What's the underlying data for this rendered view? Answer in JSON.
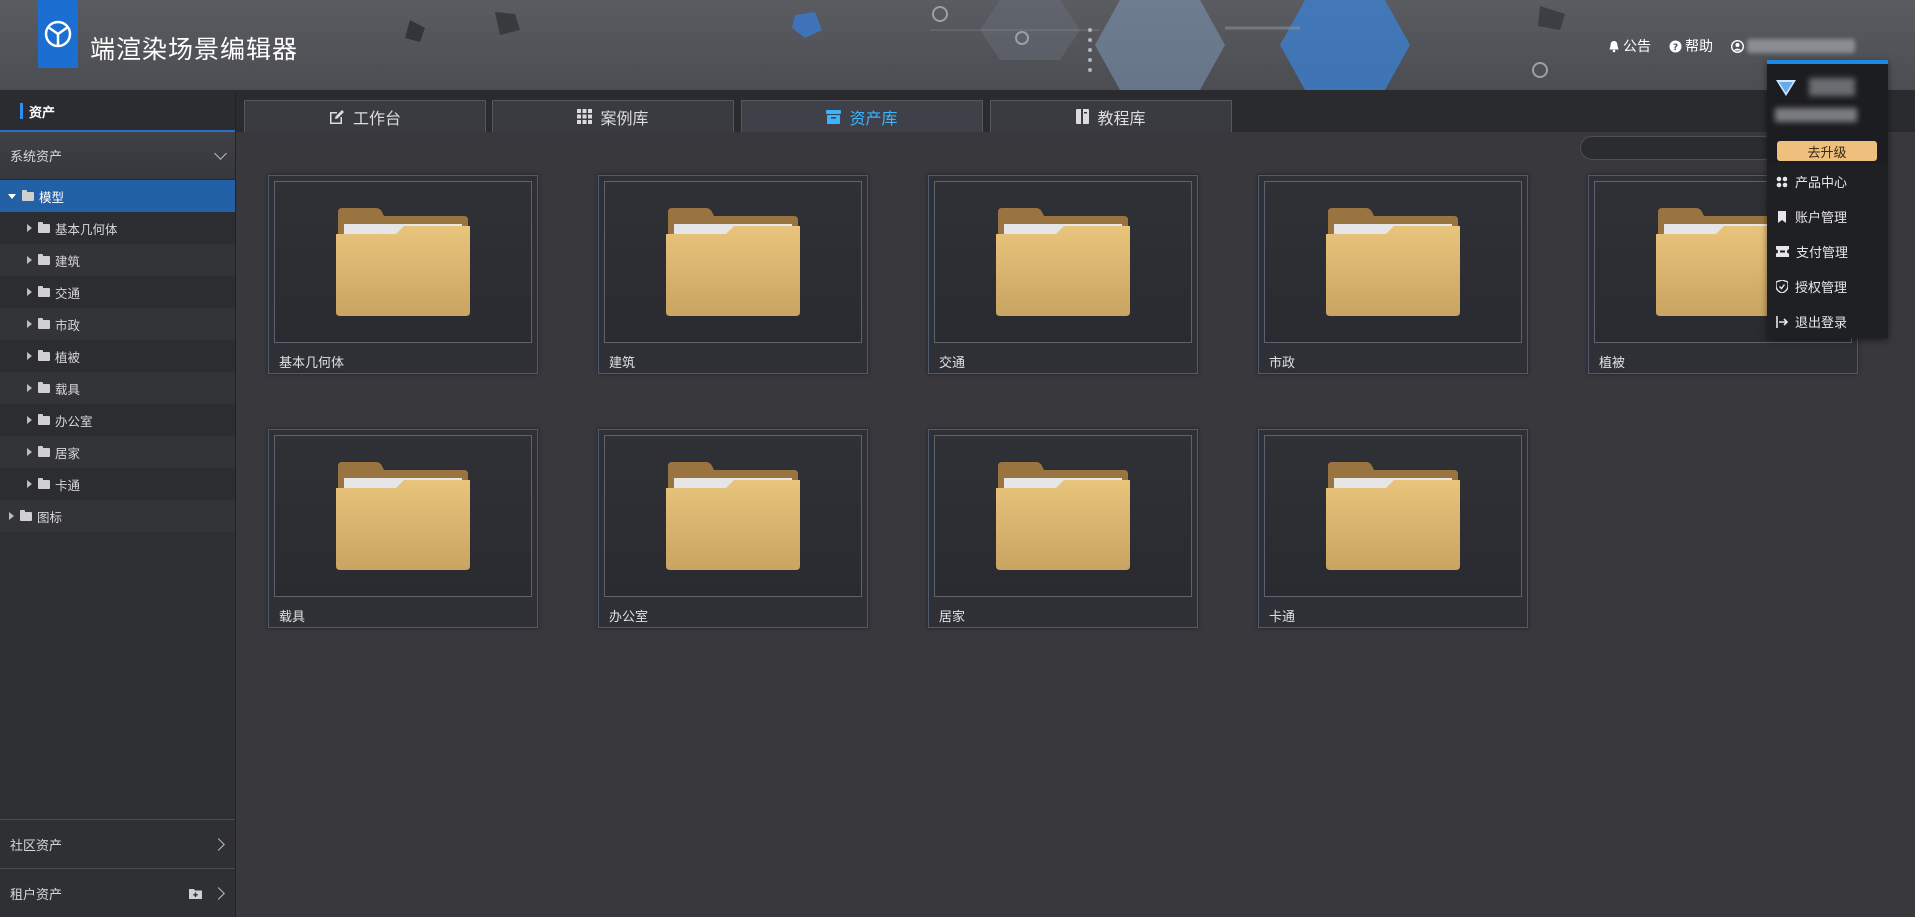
{
  "header": {
    "title": "端渲染场景编辑器",
    "notice_label": "公告",
    "help_label": "帮助",
    "logo_color": "#1c6fd1"
  },
  "sidebar": {
    "top_label": "资产",
    "system_section": "系统资产",
    "tree": [
      {
        "label": "模型",
        "expanded": true
      },
      {
        "label": "基本几何体"
      },
      {
        "label": "建筑"
      },
      {
        "label": "交通"
      },
      {
        "label": "市政"
      },
      {
        "label": "植被"
      },
      {
        "label": "载具"
      },
      {
        "label": "办公室"
      },
      {
        "label": "居家"
      },
      {
        "label": "卡通"
      },
      {
        "label": "图标"
      }
    ],
    "community_section": "社区资产",
    "tenant_section": "租户资产"
  },
  "tabs": [
    {
      "label": "工作台",
      "icon": "edit-icon"
    },
    {
      "label": "案例库",
      "icon": "grid-icon"
    },
    {
      "label": "资产库",
      "icon": "archive-icon",
      "active": true
    },
    {
      "label": "教程库",
      "icon": "book-icon"
    }
  ],
  "cards": [
    {
      "label": "基本几何体"
    },
    {
      "label": "建筑"
    },
    {
      "label": "交通"
    },
    {
      "label": "市政"
    },
    {
      "label": "植被"
    },
    {
      "label": "载具"
    },
    {
      "label": "办公室"
    },
    {
      "label": "居家"
    },
    {
      "label": "卡通"
    }
  ],
  "user_menu": {
    "upgrade_label": "去升级",
    "items": [
      {
        "label": "产品中心",
        "icon": "apps-icon"
      },
      {
        "label": "账户管理",
        "icon": "bookmark-icon"
      },
      {
        "label": "支付管理",
        "icon": "ticket-icon"
      },
      {
        "label": "授权管理",
        "icon": "shield-icon"
      },
      {
        "label": "退出登录",
        "icon": "logout-icon"
      }
    ]
  },
  "colors": {
    "accent": "#39b5ff",
    "active_row": "#2361a6",
    "upgrade": "#eebf7d"
  }
}
